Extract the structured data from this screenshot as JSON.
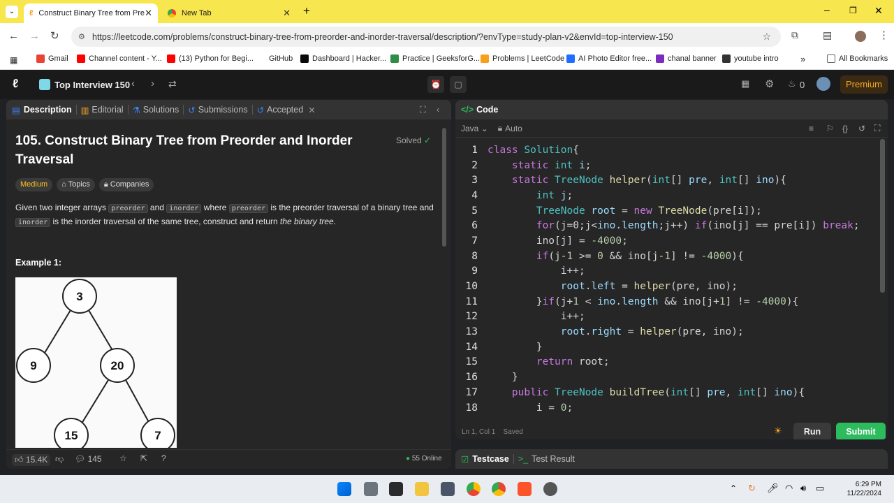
{
  "browser": {
    "tabs": [
      {
        "title": "Construct Binary Tree from Pre"
      },
      {
        "title": "New Tab"
      }
    ],
    "url": "https://leetcode.com/problems/construct-binary-tree-from-preorder-and-inorder-traversal/description/?envType=study-plan-v2&envId=top-interview-150",
    "bookmarks": [
      "Gmail",
      "Channel content - Y...",
      "(13) Python for Begi...",
      "GitHub",
      "Dashboard | Hacker...",
      "Practice | GeeksforG...",
      "Problems | LeetCode",
      "AI Photo Editor free...",
      "chanal banner",
      "youtube intro"
    ],
    "all_bookmarks": "All Bookmarks"
  },
  "nav": {
    "study_plan": "Top Interview 150",
    "streak": "0",
    "premium": "Premium"
  },
  "left": {
    "tabs": [
      "Description",
      "Editorial",
      "Solutions",
      "Submissions",
      "Accepted"
    ],
    "title": "105. Construct Binary Tree from Preorder and Inorder Traversal",
    "solved": "Solved",
    "difficulty": "Medium",
    "topics": "Topics",
    "companies": "Companies",
    "desc_1": "Given two integer arrays",
    "code_pre": "preorder",
    "and": "and",
    "code_in": "inorder",
    "where": "where",
    "desc_2": "is the preorder traversal of a binary tree and",
    "desc_3": "is the inorder traversal of the same tree, construct and return",
    "desc_em": "the binary tree.",
    "example": "Example 1:",
    "tree_nodes": [
      "3",
      "9",
      "20",
      "15",
      "7"
    ],
    "likes": "15.4K",
    "comments": "145",
    "online": "55 Online"
  },
  "right": {
    "header": "Code",
    "lang": "Java",
    "auto": "Auto",
    "status": "Ln 1, Col 1",
    "saved": "Saved",
    "run": "Run",
    "submit": "Submit",
    "testcase": "Testcase",
    "test_result": "Test Result",
    "line_numbers": [
      "1",
      "2",
      "3",
      "4",
      "5",
      "6",
      "7",
      "8",
      "9",
      "10",
      "11",
      "12",
      "13",
      "14",
      "15",
      "16",
      "17",
      "18"
    ]
  },
  "taskbar": {
    "time": "6:29 PM",
    "date": "11/22/2024"
  }
}
